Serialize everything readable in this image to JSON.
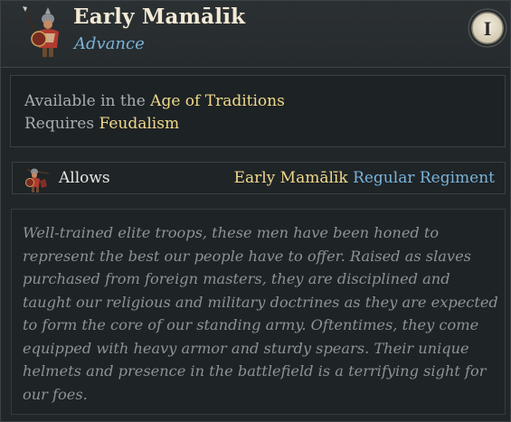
{
  "header": {
    "title": "Early Mamālīk",
    "subtitle": "Advance",
    "unit_icon": "soldier-portrait-icon",
    "era_badge": {
      "icon": "era-badge-icon",
      "numeral": "I"
    }
  },
  "requirements": {
    "line1_prefix": "Available in the",
    "line1_value": "Age of Traditions",
    "line2_prefix": "Requires",
    "line2_value": "Feudalism"
  },
  "allows": {
    "icon": "regiment-soldier-icon",
    "label": "Allows",
    "unit_name": "Early Mamālīk",
    "unit_type": "Regular Regiment"
  },
  "description": {
    "text": "Well-trained elite troops, these men have been honed to represent the best our people have to offer. Raised as slaves purchased from foreign masters, they are disciplined and taught our religious and military doctrines as they are expected to form the core of our standing army. Oftentimes, they come equipped with heavy armor and sturdy spears. Their unique helmets and presence in the battlefield is a terrifying sight for our foes."
  },
  "colors": {
    "background": "#212629",
    "title": "#f3ead6",
    "highlight_gold": "#f0d98a",
    "highlight_blue": "#7ab3d8",
    "body_text": "#a9aeb1",
    "description_text": "#8d9296"
  }
}
